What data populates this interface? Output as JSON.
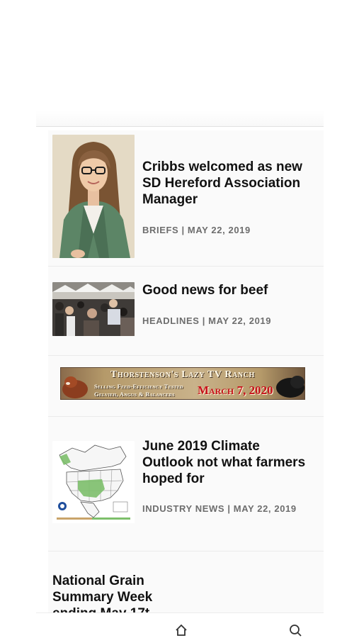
{
  "articles": [
    {
      "headline": "Cribbs welcomed as new SD Hereford Association Manager",
      "meta": "BRIEFS | MAY 22, 2019",
      "thumbnail": "portrait-photo"
    },
    {
      "headline": "Good news for beef",
      "meta": "HEADLINES | MAY 22, 2019",
      "thumbnail": "crowd-photo"
    },
    {
      "headline": "June 2019 Climate Outlook not what farmers hoped for",
      "meta": "INDUSTRY NEWS | MAY 22, 2019",
      "thumbnail": "north-america-map"
    },
    {
      "headline": "National Grain Summary Week ending May 17t"
    }
  ],
  "ad": {
    "title": "Thorstenson's Lazy TV Ranch",
    "line1": "Selling Feed-Efficiency Tested",
    "line2": "Gelvieh, Angus & Balancers",
    "date": "March 7, 2020",
    "colors": {
      "date": "#c8121b",
      "background": "#b59a6a"
    }
  },
  "bottom_nav": {
    "icons": [
      "home-icon",
      "search-icon"
    ]
  }
}
